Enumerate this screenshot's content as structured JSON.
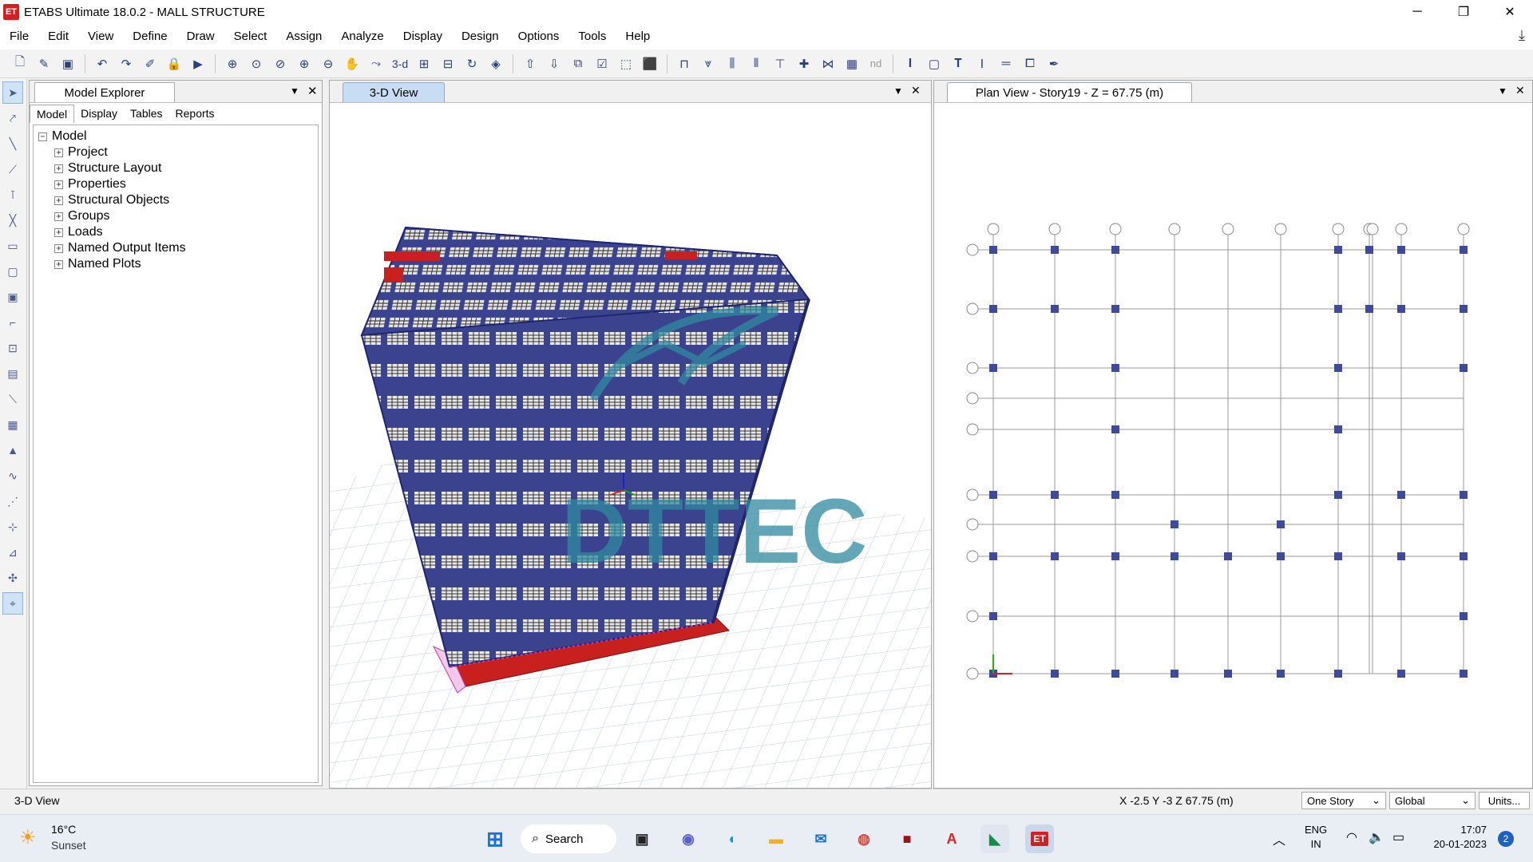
{
  "window": {
    "title": "ETABS Ultimate 18.0.2 - MALL STRUCTURE",
    "app_icon": "ET",
    "controls": {
      "minimize": "─",
      "restore": "❐",
      "close": "✕"
    }
  },
  "menu": [
    "File",
    "Edit",
    "View",
    "Define",
    "Draw",
    "Select",
    "Assign",
    "Analyze",
    "Display",
    "Design",
    "Options",
    "Tools",
    "Help"
  ],
  "toolbar": {
    "label_3d": "3-d",
    "label_nd": "nd"
  },
  "explorer": {
    "title": "Model Explorer",
    "tabs": [
      "Model",
      "Display",
      "Tables",
      "Reports"
    ],
    "root": "Model",
    "items": [
      "Project",
      "Structure Layout",
      "Properties",
      "Structural Objects",
      "Groups",
      "Loads",
      "Named Output Items",
      "Named Plots"
    ]
  },
  "view3d": {
    "tab": "3-D View",
    "watermark": "DTTEC"
  },
  "planview": {
    "tab": "Plan View - Story19 - Z = 67.75 (m)"
  },
  "status": {
    "view": "3-D View",
    "coords": "X -2.5  Y -3  Z 67.75 (m)",
    "story_select": "One Story",
    "coord_system": "Global",
    "units_button": "Units..."
  },
  "taskbar": {
    "weather_temp": "16°C",
    "weather_desc": "Sunset",
    "search": "Search",
    "lang1": "ENG",
    "lang2": "IN",
    "time": "17:07",
    "date": "20-01-2023",
    "notifications": "2"
  },
  "colors": {
    "frame": "#2f3a8f",
    "wall": "#c8201e",
    "grid": "#9fb4cf",
    "watermark": "#2f8aa0",
    "plan_node": "#3f4a9a"
  }
}
